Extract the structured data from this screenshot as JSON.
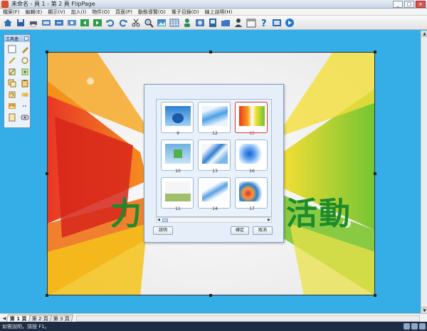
{
  "titlebar": {
    "title": "未命名 - 頁 1 - 第 2 頁 FlipPage",
    "min_label": "_",
    "max_label": "□",
    "close_label": "x"
  },
  "menu": [
    "檔案(F)",
    "編輯(E)",
    "顯示(V)",
    "加入(I)",
    "物件(O)",
    "頁面(P)",
    "動態導覽(G)",
    "電子目錄(D)",
    "線上說明(H)"
  ],
  "toolbar_icons": [
    "home-icon",
    "save-icon",
    "print-icon",
    "preview-icon",
    "export-icon",
    "screen-icon",
    "flip-left-icon",
    "flip-right-icon",
    "undo-icon",
    "redo-icon",
    "cut-icon",
    "zoom-icon",
    "image-icon",
    "table-icon",
    "user-icon",
    "photo-icon",
    "album-icon",
    "folder-icon",
    "person-icon",
    "calendar-icon",
    "help-icon",
    "settings-icon",
    "play-icon"
  ],
  "toolbox": {
    "title": "工具盒"
  },
  "canvas": {
    "text_left": "力",
    "text_right": "活動"
  },
  "dialog": {
    "thumbs": [
      {
        "label": "9"
      },
      {
        "label": "12"
      },
      {
        "label": "15"
      },
      {
        "label": "10"
      },
      {
        "label": "13"
      },
      {
        "label": "16"
      },
      {
        "label": "11"
      },
      {
        "label": "14"
      },
      {
        "label": "17"
      }
    ],
    "help_label": "說明",
    "ok_label": "確定",
    "cancel_label": "取消"
  },
  "pagetabs": [
    {
      "label": "第 1 頁",
      "active": true
    },
    {
      "label": "第 2 頁",
      "active": false
    },
    {
      "label": "第 3 頁",
      "active": false
    }
  ],
  "status": {
    "text": "如需說明，請按 F1。"
  }
}
